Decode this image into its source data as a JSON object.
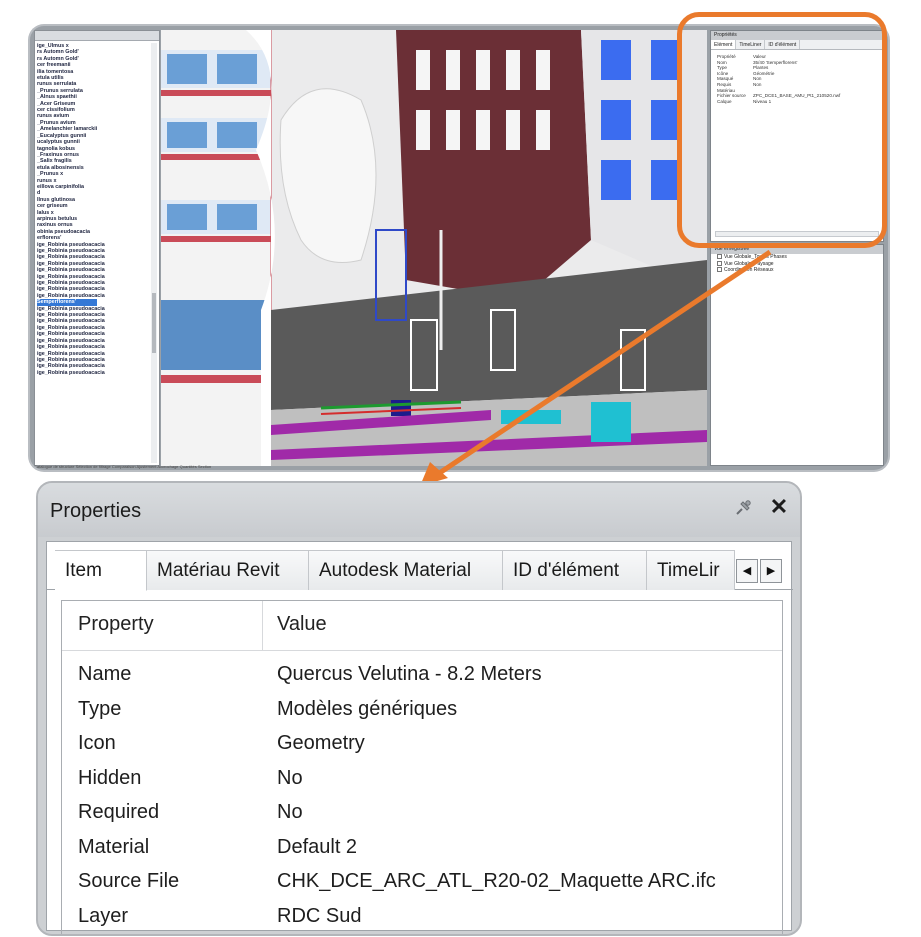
{
  "top_screenshot": {
    "tree_items": [
      "ige_Ulmus x",
      "rs Automn Gold'",
      "rs Automn Gold'",
      "cer freemanii",
      "ilia tomentosa",
      "etula utilis",
      "runus serrulata",
      "_Prunus serrulata",
      "_Alnus spaethii",
      "_Acer Griseum",
      "cer cissifolium",
      "runus avium",
      "_Prunus avium",
      "_Amelanchier lamarckii",
      "_Eucalyptus gunnii",
      "ucalyptus gunnii",
      "tagnolia kobus",
      "_Fraxinus ornus",
      "_Salix fragilis",
      "etula albosinensis",
      "_Prunus x",
      "runus x",
      "eillova carpinifolia",
      "d",
      "Ilnus glutinosa",
      "cer griseum",
      "lalus x",
      "arpinus betulus",
      "raxinus ornus",
      "obinia pseudoacacia",
      "erflorens'",
      "ige_Robinia pseudoacacia",
      "ige_Robinia pseudoacacia",
      "ige_Robinia pseudoacacia",
      "ige_Robinia pseudoacacia",
      "ige_Robinia pseudoacacia",
      "ige_Robinia pseudoacacia",
      "ige_Robinia pseudoacacia",
      "ige_Robinia pseudoacacia",
      "ige_Robinia pseudoacacia",
      "Semperflorens'",
      "ige_Robinia pseudoacacia",
      "ige_Robinia pseudoacacia",
      "ige_Robinia pseudoacacia",
      "ige_Robinia pseudoacacia",
      "ige_Robinia pseudoacacia",
      "ige_Robinia pseudoacacia",
      "ige_Robinia pseudoacacia",
      "ige_Robinia pseudoacacia",
      "ige_Robinia pseudoacacia",
      "ige_Robinia pseudoacacia",
      "ige_Robinia pseudoacacia"
    ],
    "selected_index": 40,
    "mini_properties": {
      "title": "Propriétés",
      "tabs": [
        "Elément",
        "TimeLiner",
        "ID d'élément"
      ],
      "rows": [
        {
          "k": "Propriété",
          "v": "Valeur"
        },
        {
          "k": "Nom",
          "v": "35/40 'Semperflorens'"
        },
        {
          "k": "Type",
          "v": "Plantes"
        },
        {
          "k": "Icône",
          "v": "Géométrie"
        },
        {
          "k": "Masqué",
          "v": "Non"
        },
        {
          "k": "Requis",
          "v": "Non"
        },
        {
          "k": "Matériau",
          "v": ""
        },
        {
          "k": "Fichier source",
          "v": "ZPC_DCE1_BASE_AMU_Pt1_210520.nwf"
        },
        {
          "k": "Calque",
          "v": "Niveau 1"
        }
      ]
    },
    "mini_nav": {
      "title": "Vue enregistrée",
      "items": [
        "Vue Globale_Toutes Phases",
        "Vue Globale_Paysage",
        "Coordination Réseaux"
      ]
    },
    "status_text": "Catalogue de structure  Sélection de filtrage  Comparaison  Ajustement  Accrochage  Quantités  Section"
  },
  "properties": {
    "title": "Properties",
    "pin_icon": "pin-icon",
    "close_glyph": "✕",
    "tabs": [
      "Item",
      "Matériau Revit",
      "Autodesk Material",
      "ID d'élément",
      "TimeLir"
    ],
    "tab_prev": "◀",
    "tab_next": "▶",
    "header_property": "Property",
    "header_value": "Value",
    "rows": [
      {
        "key": "Name",
        "value": "Quercus Velutina - 8.2 Meters"
      },
      {
        "key": "Type",
        "value": "Modèles génériques"
      },
      {
        "key": "Icon",
        "value": "Geometry"
      },
      {
        "key": "Hidden",
        "value": "No"
      },
      {
        "key": "Required",
        "value": "No"
      },
      {
        "key": "Material",
        "value": "Default 2"
      },
      {
        "key": "Source File",
        "value": "CHK_DCE_ARC_ATL_R20-02_Maquette ARC.ifc"
      },
      {
        "key": "Layer",
        "value": "RDC Sud"
      }
    ]
  },
  "colors": {
    "highlight": "#ea7a2c",
    "selection": "#3478d6"
  }
}
